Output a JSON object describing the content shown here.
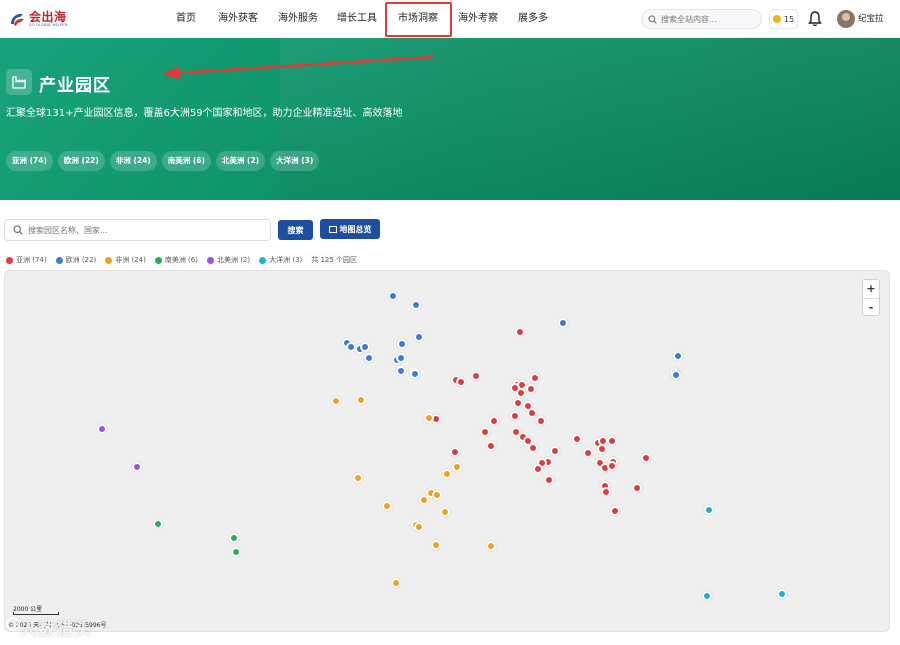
{
  "header": {
    "logo_title": "会出海",
    "logo_sub": "GO GLOBAL HELPER",
    "nav": [
      {
        "label": "首页"
      },
      {
        "label": "海外获客"
      },
      {
        "label": "海外服务"
      },
      {
        "label": "增长工具"
      },
      {
        "label": "市场洞察"
      },
      {
        "label": "海外考察"
      },
      {
        "label": "展多多"
      }
    ],
    "search_placeholder": "搜索全站内容...",
    "coins": "15",
    "user_name": "纪宝拉"
  },
  "hero": {
    "title": "产业园区",
    "description": "汇聚全球131+产业园区信息，覆盖6大洲59个国家和地区，助力企业精准选址、高效落地",
    "chips": [
      {
        "label": "亚洲 (74)"
      },
      {
        "label": "欧洲 (22)"
      },
      {
        "label": "非洲 (24)"
      },
      {
        "label": "南美洲 (6)"
      },
      {
        "label": "北美洲 (2)"
      },
      {
        "label": "大洋洲 (3)"
      }
    ]
  },
  "search": {
    "placeholder": "搜索园区名称、国家...",
    "search_label": "搜索",
    "map_label": "地图总览"
  },
  "legend": {
    "items": [
      {
        "label": "亚洲 (74)",
        "color": "#e03c3c"
      },
      {
        "label": "欧洲 (22)",
        "color": "#3b78e0"
      },
      {
        "label": "非洲 (24)",
        "color": "#f0a01e"
      },
      {
        "label": "南美洲 (6)",
        "color": "#27b14f"
      },
      {
        "label": "北美洲 (2)",
        "color": "#a04fe0"
      },
      {
        "label": "大洋洲 (3)",
        "color": "#17b4d4"
      }
    ],
    "total": "共 125 个园区"
  },
  "map": {
    "zoom_in": "+",
    "zoom_out": "-",
    "scale_label": "2000 公里",
    "copyright": "© 2025 天地图 · GS(2025)5996号",
    "watermark": "人数猎头"
  },
  "colors": {
    "asia": "#e03c3c",
    "europe": "#3b78e0",
    "africa": "#f0a01e",
    "south_america": "#27b14f",
    "north_america": "#a04fe0",
    "oceania": "#17b4d4",
    "brand_blue": "#1e4e9f",
    "hero_green": "#0d8f65"
  }
}
